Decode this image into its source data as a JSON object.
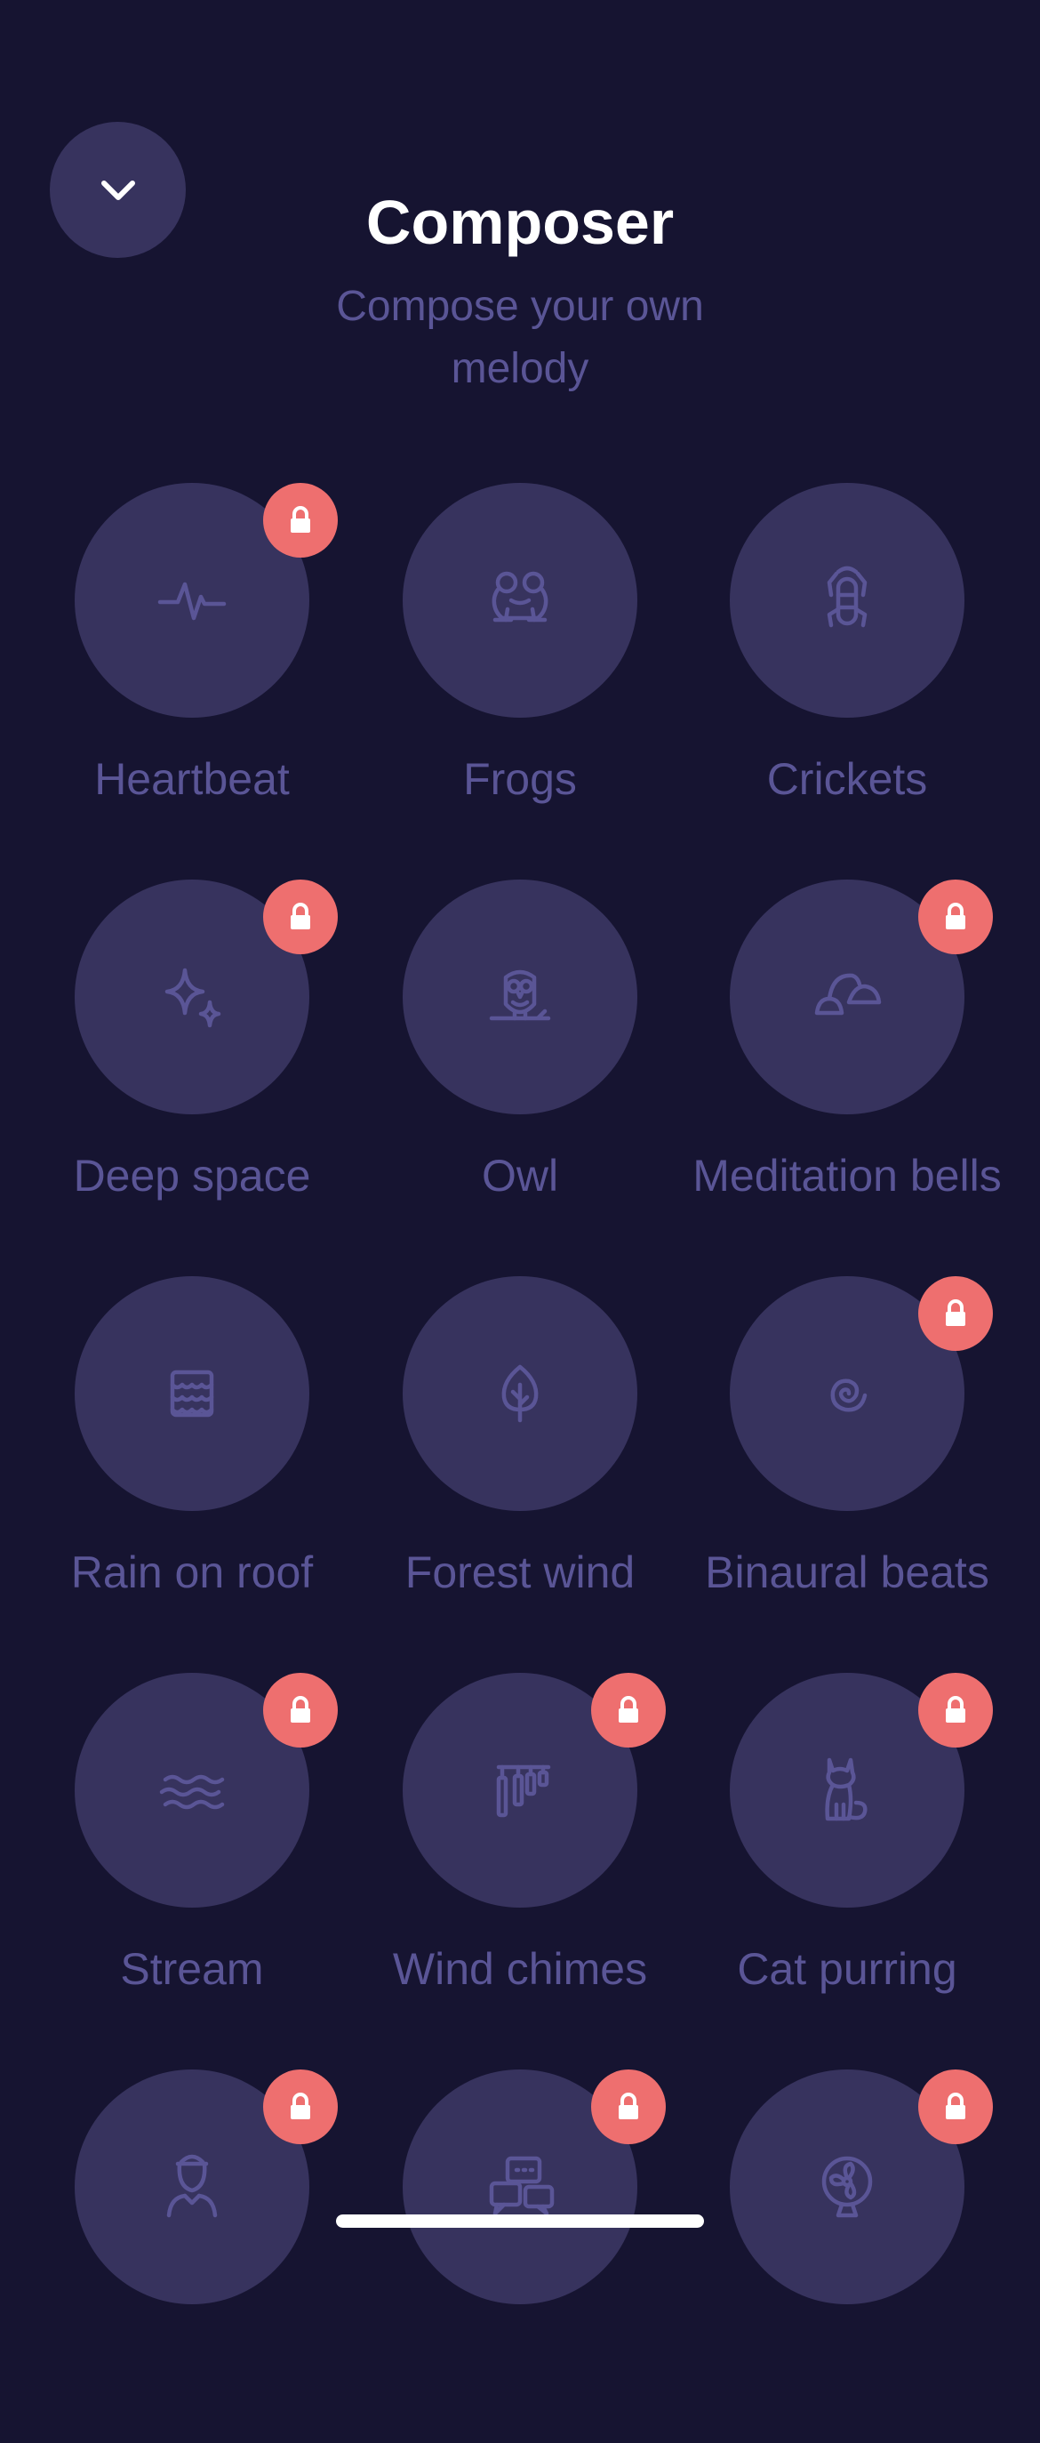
{
  "header": {
    "title": "Composer",
    "subtitle": "Compose your own melody",
    "close_icon": "chevron-down-icon"
  },
  "colors": {
    "background": "#161431",
    "tile": "#37335e",
    "text_muted": "#5a5596",
    "lock_badge": "#ee6f6f"
  },
  "sounds": [
    {
      "label": "Heartbeat",
      "icon": "heartbeat-icon",
      "locked": true
    },
    {
      "label": "Frogs",
      "icon": "frog-icon",
      "locked": false
    },
    {
      "label": "Crickets",
      "icon": "cricket-icon",
      "locked": false
    },
    {
      "label": "Deep space",
      "icon": "sparkles-icon",
      "locked": true
    },
    {
      "label": "Owl",
      "icon": "owl-icon",
      "locked": false
    },
    {
      "label": "Meditation bells",
      "icon": "bells-icon",
      "locked": true
    },
    {
      "label": "Rain on roof",
      "icon": "roof-tiles-icon",
      "locked": false
    },
    {
      "label": "Forest wind",
      "icon": "leaf-icon",
      "locked": false
    },
    {
      "label": "Binaural beats",
      "icon": "spiral-icon",
      "locked": true
    },
    {
      "label": "Stream",
      "icon": "waves-icon",
      "locked": true
    },
    {
      "label": "Wind chimes",
      "icon": "wind-chimes-icon",
      "locked": true
    },
    {
      "label": "Cat purring",
      "icon": "cat-icon",
      "locked": true
    },
    {
      "label": "",
      "icon": "person-icon",
      "locked": true
    },
    {
      "label": "",
      "icon": "chat-bubbles-icon",
      "locked": true
    },
    {
      "label": "",
      "icon": "fan-icon",
      "locked": true
    }
  ]
}
